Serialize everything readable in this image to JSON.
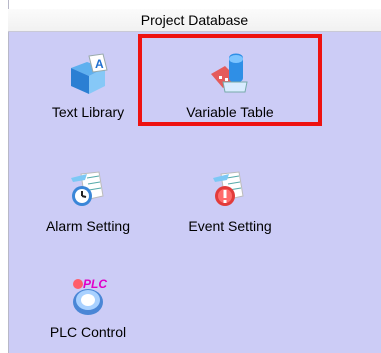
{
  "header": {
    "title": "Project Database"
  },
  "items": [
    {
      "label": "Text Library",
      "icon": "text-library-icon"
    },
    {
      "label": "Variable Table",
      "icon": "variable-table-icon"
    },
    {
      "label": "Alarm Setting",
      "icon": "alarm-setting-icon"
    },
    {
      "label": "Event Setting",
      "icon": "event-setting-icon"
    },
    {
      "label": "PLC Control",
      "icon": "plc-control-icon"
    }
  ],
  "colors": {
    "panel_background": "#ccccf6",
    "highlight_border": "#ee1111"
  }
}
